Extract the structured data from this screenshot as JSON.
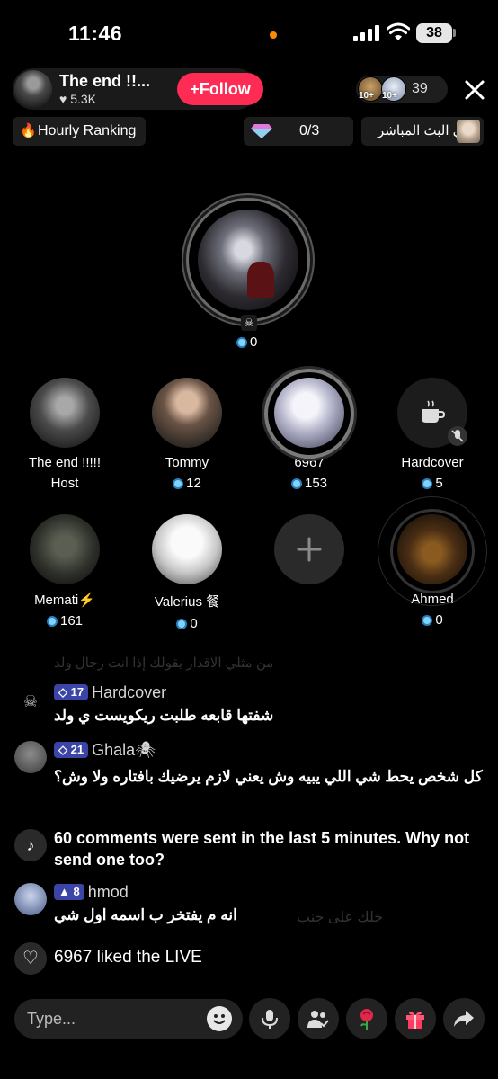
{
  "status_bar": {
    "time": "11:46",
    "battery": "38"
  },
  "host": {
    "name": "The end !!...",
    "likes": "5.3K",
    "follow_label": "Follow"
  },
  "viewers": {
    "badge_1": "10+",
    "badge_2": "10+",
    "count": "39"
  },
  "chips": {
    "ranking": "Hourly Ranking",
    "gems": "0/3",
    "live_label": "في البث المباشر"
  },
  "main_seat": {
    "coins": "0"
  },
  "seats": [
    {
      "name": "The end !!!!!",
      "sub": "Host"
    },
    {
      "name": "Tommy",
      "coins": "12"
    },
    {
      "name": "6967",
      "coins": "153"
    },
    {
      "name": "Hardcover",
      "coins": "5"
    },
    {
      "name": "Memati⚡",
      "coins": "161"
    },
    {
      "name": "Valerius 餐",
      "coins": "0"
    },
    {
      "name": "Ahmed",
      "coins": "0"
    }
  ],
  "chat": {
    "faded_top": "من مثلي الاقدار يقولك إذا انت رجال ولد",
    "messages": [
      {
        "level": "17",
        "user": "Hardcover",
        "text": "شفتها قابعه طلبت ريكويست ي ولد"
      },
      {
        "level": "21",
        "user": "Ghala🕷",
        "text": "كل شخص يحط شي اللي يبيه وش يعني لازم يرضيك بافتاره ولا وش؟"
      },
      {
        "system": "60 comments were sent in the last 5 minutes. Why not send one too?"
      },
      {
        "level": "8",
        "user": "hmod",
        "text": "انه م يفتخر ب اسمه اول شي"
      }
    ],
    "faded_bottom": "خلك على جنب",
    "like_event": {
      "user": "6967",
      "action": "liked the LIVE"
    }
  },
  "input": {
    "placeholder": "Type..."
  },
  "colors": {
    "follow": "#fe2c55",
    "level_badge": "#3b45a8",
    "coin": "#7fd3ff"
  }
}
